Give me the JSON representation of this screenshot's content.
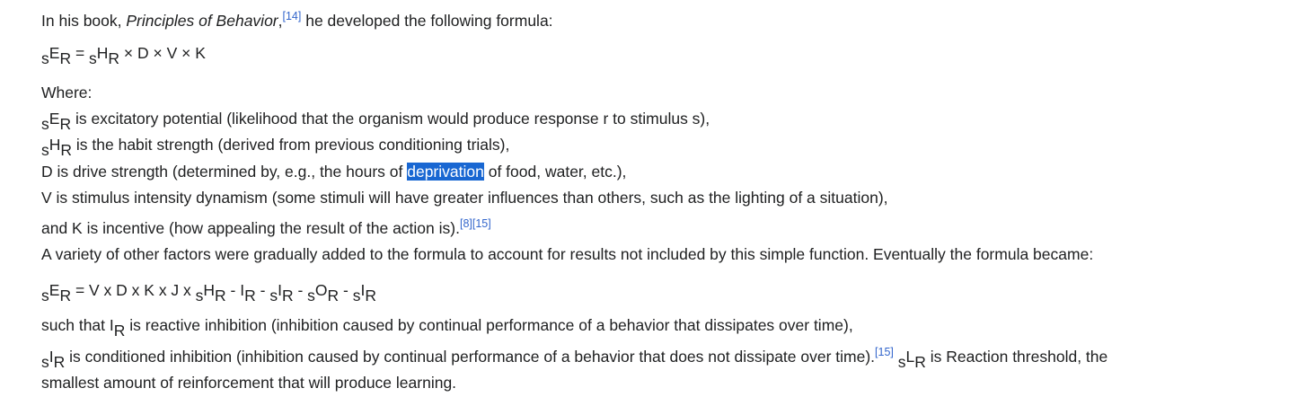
{
  "p1": {
    "pre": "In his book, ",
    "book_title": "Principles of Behavior",
    "comma": ",",
    "ref": "[14]",
    "post": " he developed the following formula:"
  },
  "formula1": {
    "pre": "s",
    "e": "E",
    "r": "R",
    "eq": " = ",
    "pre2": "s",
    "h": "H",
    "r2": "R",
    "rest": " × D × V × K"
  },
  "defs": {
    "where": "Where:",
    "line1_pre": "s",
    "line1_e": "E",
    "line1_r": "R",
    "line1_text": " is excitatory potential (likelihood that the organism would produce response r to stimulus s),",
    "line2_pre": "s",
    "line2_h": "H",
    "line2_r": "R",
    "line2_text": " is the habit strength (derived from previous conditioning trials),",
    "line3_pre": "D is drive strength (determined by, e.g., the hours of ",
    "line3_sel": "deprivation",
    "line3_post": " of food, water, etc.),",
    "line4": "V is stimulus intensity dynamism (some stimuli will have greater influences than others, such as the lighting of a situation),",
    "line5": "and K is incentive (how appealing the result of the action is).",
    "ref_a": "[8]",
    "ref_b": "[15]"
  },
  "p3": {
    "text": "A variety of other factors were gradually added to the formula to account for results not included by this simple function. Eventually the formula became:"
  },
  "formula2": {
    "s1": "s",
    "E": "E",
    "r1": "R",
    "mid": " = V x D x K x J x ",
    "s2": "s",
    "H": "H",
    "r2": "R",
    "m1": " - ",
    "I": "I",
    "r3": "R",
    "m2": " - ",
    "s3": "s",
    "I2": "I",
    "r4": "R",
    "m3": " - ",
    "s4": "s",
    "O": "O",
    "r5": "R",
    "m4": " - ",
    "s5": "s",
    "I3": "I",
    "r6": "R"
  },
  "p4": {
    "l1_pre": "such that ",
    "l1_i": "I",
    "l1_r": "R",
    "l1_text": " is reactive inhibition (inhibition caused by continual performance of a behavior that dissipates over time),",
    "l2_s": "s",
    "l2_i": "I",
    "l2_r": "R",
    "l2_text": " is conditioned inhibition (inhibition caused by continual performance of a behavior that does not dissipate over time).",
    "ref": "[15]",
    "l2_sp": " ",
    "l2_s2": "s",
    "l2_l": "L",
    "l2_r2": "R",
    "l2_tail": " is Reaction threshold, the",
    "l3": "smallest amount of reinforcement that will produce learning."
  }
}
